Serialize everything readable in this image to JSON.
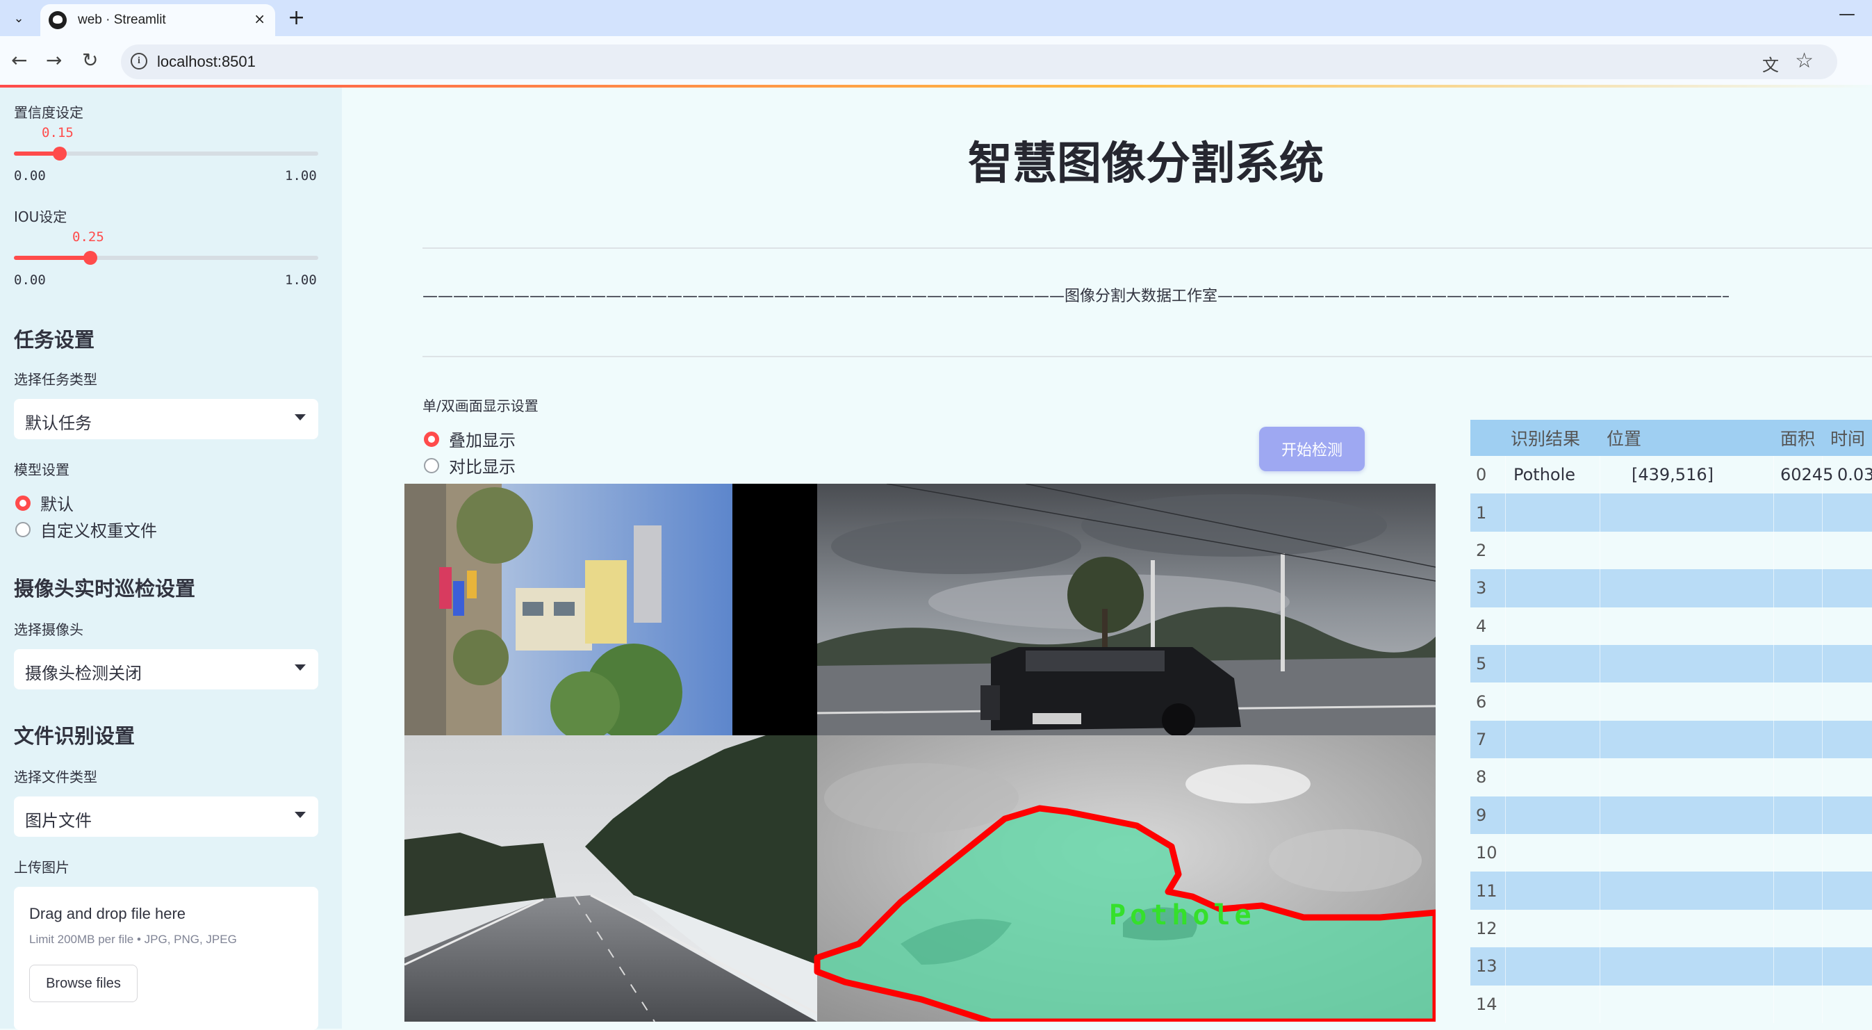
{
  "browser": {
    "tab_title": "web · Streamlit",
    "url": "localhost:8501",
    "new_tab_symbol": "+",
    "close_symbol": "×"
  },
  "sidebar": {
    "confidence": {
      "label": "置信度设定",
      "value": 0.15,
      "value_text": "0.15",
      "min": "0.00",
      "max": "1.00"
    },
    "iou": {
      "label": "IOU设定",
      "value": 0.25,
      "value_text": "0.25",
      "min": "0.00",
      "max": "1.00"
    },
    "task_section": "任务设置",
    "task_type_label": "选择任务类型",
    "task_type_value": "默认任务",
    "model_label": "模型设置",
    "model_options": [
      "默认",
      "自定义权重文件"
    ],
    "model_selected": 0,
    "camera_section": "摄像头实时巡检设置",
    "camera_label": "选择摄像头",
    "camera_value": "摄像头检测关闭",
    "file_section": "文件识别设置",
    "file_type_label": "选择文件类型",
    "file_type_value": "图片文件",
    "upload_label": "上传图片",
    "upload_drop": "Drag and drop file here",
    "upload_limit": "Limit 200MB per file • JPG, PNG, JPEG",
    "upload_button": "Browse files"
  },
  "main": {
    "title": "智慧图像分割系统",
    "divider_text": "——————————————————————————————————————————图像分割大数据工作室——————————————————————————————————————————",
    "display_mode_label": "单/双画面显示设置",
    "display_options": [
      "叠加显示",
      "对比显示"
    ],
    "display_selected": 0,
    "start_button": "开始检测",
    "detection_label": "Pothole"
  },
  "results_table": {
    "headers": [
      "识别结果",
      "位置",
      "面积",
      "时间"
    ],
    "rows": [
      {
        "index": "0",
        "result": "Pothole",
        "position": "[439,516]",
        "area": "60245",
        "time": "0.03"
      },
      {
        "index": "1"
      },
      {
        "index": "2"
      },
      {
        "index": "3"
      },
      {
        "index": "4"
      },
      {
        "index": "5"
      },
      {
        "index": "6"
      },
      {
        "index": "7"
      },
      {
        "index": "8"
      },
      {
        "index": "9"
      },
      {
        "index": "10"
      },
      {
        "index": "11"
      },
      {
        "index": "12"
      },
      {
        "index": "13"
      },
      {
        "index": "14"
      }
    ]
  },
  "colors": {
    "accent": "#ff4b4b",
    "sidebar_bg": "#e3f3f8",
    "page_bg": "#f0fbfc",
    "button_bg": "#9ea8f2",
    "table_header": "#9fcff2",
    "table_alt_row": "#b9dcf6",
    "segment_outline": "#ff0000",
    "segment_fill": "#5fd8a6"
  }
}
